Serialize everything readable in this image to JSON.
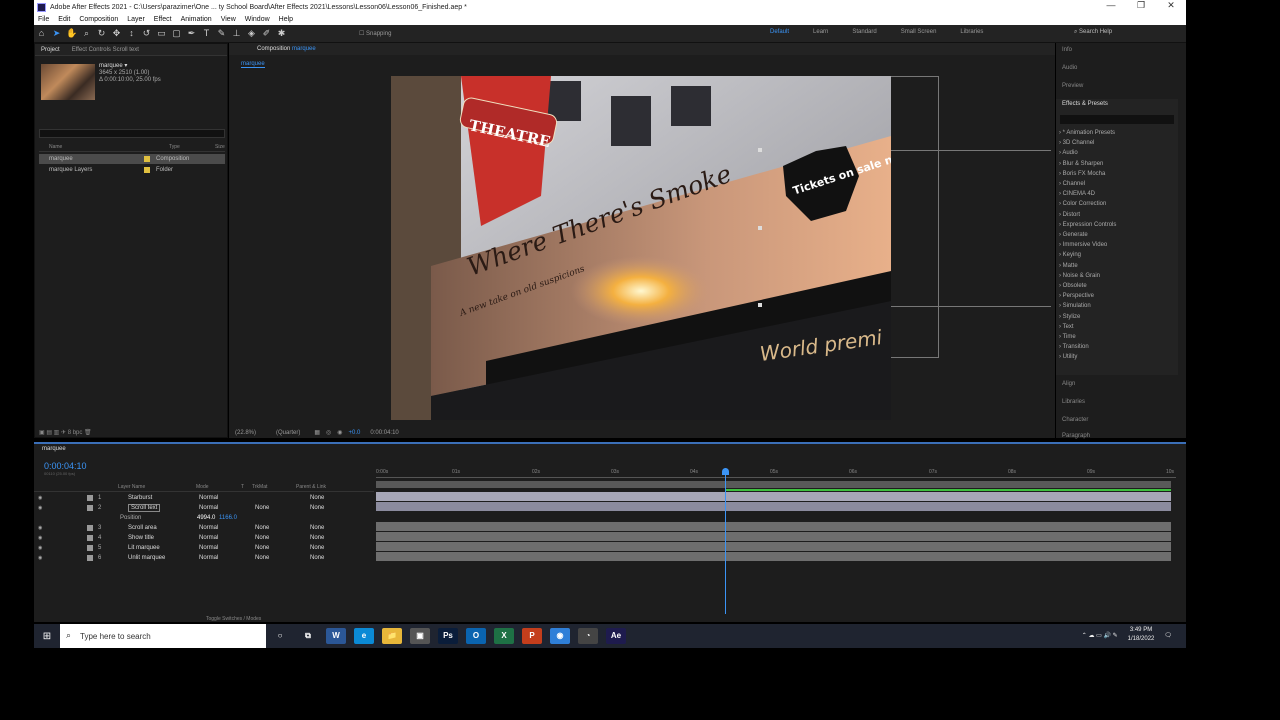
{
  "window": {
    "title": "Adobe After Effects 2021 - C:\\Users\\parazimer\\One ... ty School Board\\After Effects 2021\\Lessons\\Lesson06\\Lesson06_Finished.aep *",
    "min": "—",
    "max": "❐",
    "close": "✕"
  },
  "menu": [
    "File",
    "Edit",
    "Composition",
    "Layer",
    "Effect",
    "Animation",
    "View",
    "Window",
    "Help"
  ],
  "toolbar": {
    "snapping": "Snapping",
    "workspaces": [
      "Default",
      "Learn",
      "Standard",
      "Small Screen",
      "Libraries"
    ],
    "search_help": "Search Help"
  },
  "project": {
    "tab": "Project",
    "effect_tab": "Effect Controls Scroll text",
    "comp_name": "marquee ▾",
    "comp_info": [
      "3645 x 2510 (1.00)",
      "Δ 0:00:10:00, 25.00 fps"
    ],
    "headers": {
      "name": "Name",
      "type": "Type",
      "size": "Size"
    },
    "items": [
      {
        "name": "marquee",
        "type": "Composition",
        "color": "#e0c040"
      },
      {
        "name": "marquee Layers",
        "type": "Folder",
        "color": "#e0c040"
      }
    ],
    "bpc": "8 bpc"
  },
  "composition": {
    "tab": "Composition",
    "name": "marquee",
    "breadcrumb": "marquee",
    "zoom": "(22.8%)",
    "quality": "(Quarter)",
    "time": "0:00:04:10",
    "exposure": "+0.0"
  },
  "right": {
    "panels_top": [
      "Info",
      "Audio",
      "Preview"
    ],
    "effects_title": "Effects & Presets",
    "effects": [
      "* Animation Presets",
      "3D Channel",
      "Audio",
      "Blur & Sharpen",
      "Boris FX Mocha",
      "Channel",
      "CINEMA 4D",
      "Color Correction",
      "Distort",
      "Expression Controls",
      "Generate",
      "Immersive Video",
      "Keying",
      "Matte",
      "Noise & Grain",
      "Obsolete",
      "Perspective",
      "Simulation",
      "Stylize",
      "Text",
      "Time",
      "Transition",
      "Utility"
    ],
    "panels_bottom": [
      "Align",
      "Libraries",
      "Character",
      "Paragraph"
    ]
  },
  "timeline": {
    "tab": "marquee",
    "timecode": "0:00:04:10",
    "fps": "00110 (25.00 fps)",
    "headers": {
      "layer": "Layer Name",
      "mode": "Mode",
      "t": "T",
      "trkmat": "TrkMat",
      "parent": "Parent & Link"
    },
    "layers": [
      {
        "num": "1",
        "name": "Starburst",
        "mode": "Normal",
        "trk": "",
        "parent": "None"
      },
      {
        "num": "2",
        "name": "Scroll text",
        "mode": "Normal",
        "trk": "None",
        "parent": "None"
      },
      {
        "num": "",
        "name": "Position",
        "mode": "4994.0",
        "trk": "1166.0",
        "parent": ""
      },
      {
        "num": "3",
        "name": "Scroll area",
        "mode": "Normal",
        "trk": "None",
        "parent": "None"
      },
      {
        "num": "4",
        "name": "Show title",
        "mode": "Normal",
        "trk": "None",
        "parent": "None"
      },
      {
        "num": "5",
        "name": "Lit marquee",
        "mode": "Normal",
        "trk": "None",
        "parent": "None"
      },
      {
        "num": "6",
        "name": "Unlit marquee",
        "mode": "Normal",
        "trk": "None",
        "parent": "None"
      }
    ],
    "ticks": [
      "0:00s",
      "01s",
      "02s",
      "03s",
      "04s",
      "05s",
      "06s",
      "07s",
      "08s",
      "09s",
      "10s"
    ],
    "toggle": "Toggle Switches / Modes"
  },
  "scene": {
    "theatre": "THEATRE",
    "headline": "Where There's Smoke",
    "tagline": "A new take on old suspicions",
    "badge": "Tickets on sale now!",
    "scroll": "World premi"
  },
  "taskbar": {
    "search": "Type here to search",
    "time": "3:49 PM",
    "date": "1/18/2022",
    "apps": [
      {
        "label": "W",
        "color": "#2b5797"
      },
      {
        "label": "e",
        "color": "#0b8ad6"
      },
      {
        "label": "📁",
        "color": "#e8b73a"
      },
      {
        "label": "▣",
        "color": "#555"
      },
      {
        "label": "Ps",
        "color": "#0a1d3a"
      },
      {
        "label": "O",
        "color": "#0a64b0"
      },
      {
        "label": "X",
        "color": "#1e7145"
      },
      {
        "label": "P",
        "color": "#c43e1c"
      },
      {
        "label": "◉",
        "color": "#2f7fd8"
      },
      {
        "label": "◔",
        "color": "#444"
      },
      {
        "label": "Ae",
        "color": "#1e1b4e"
      }
    ]
  }
}
